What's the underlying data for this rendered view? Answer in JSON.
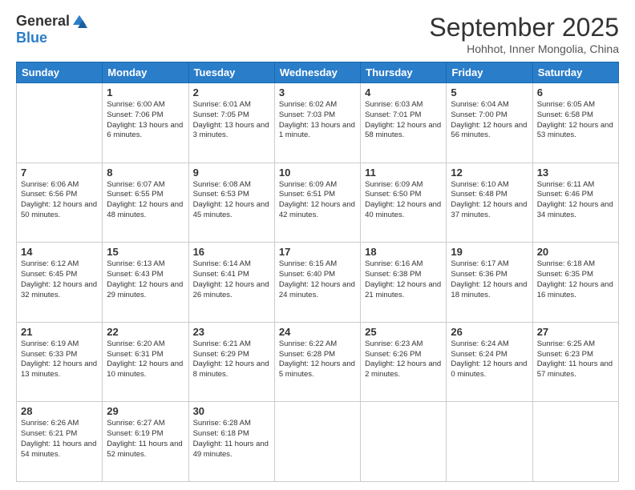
{
  "logo": {
    "general": "General",
    "blue": "Blue"
  },
  "title": "September 2025",
  "subtitle": "Hohhot, Inner Mongolia, China",
  "days_header": [
    "Sunday",
    "Monday",
    "Tuesday",
    "Wednesday",
    "Thursday",
    "Friday",
    "Saturday"
  ],
  "weeks": [
    [
      {
        "day": "",
        "sunrise": "",
        "sunset": "",
        "daylight": ""
      },
      {
        "day": "1",
        "sunrise": "Sunrise: 6:00 AM",
        "sunset": "Sunset: 7:06 PM",
        "daylight": "Daylight: 13 hours and 6 minutes."
      },
      {
        "day": "2",
        "sunrise": "Sunrise: 6:01 AM",
        "sunset": "Sunset: 7:05 PM",
        "daylight": "Daylight: 13 hours and 3 minutes."
      },
      {
        "day": "3",
        "sunrise": "Sunrise: 6:02 AM",
        "sunset": "Sunset: 7:03 PM",
        "daylight": "Daylight: 13 hours and 1 minute."
      },
      {
        "day": "4",
        "sunrise": "Sunrise: 6:03 AM",
        "sunset": "Sunset: 7:01 PM",
        "daylight": "Daylight: 12 hours and 58 minutes."
      },
      {
        "day": "5",
        "sunrise": "Sunrise: 6:04 AM",
        "sunset": "Sunset: 7:00 PM",
        "daylight": "Daylight: 12 hours and 56 minutes."
      },
      {
        "day": "6",
        "sunrise": "Sunrise: 6:05 AM",
        "sunset": "Sunset: 6:58 PM",
        "daylight": "Daylight: 12 hours and 53 minutes."
      }
    ],
    [
      {
        "day": "7",
        "sunrise": "Sunrise: 6:06 AM",
        "sunset": "Sunset: 6:56 PM",
        "daylight": "Daylight: 12 hours and 50 minutes."
      },
      {
        "day": "8",
        "sunrise": "Sunrise: 6:07 AM",
        "sunset": "Sunset: 6:55 PM",
        "daylight": "Daylight: 12 hours and 48 minutes."
      },
      {
        "day": "9",
        "sunrise": "Sunrise: 6:08 AM",
        "sunset": "Sunset: 6:53 PM",
        "daylight": "Daylight: 12 hours and 45 minutes."
      },
      {
        "day": "10",
        "sunrise": "Sunrise: 6:09 AM",
        "sunset": "Sunset: 6:51 PM",
        "daylight": "Daylight: 12 hours and 42 minutes."
      },
      {
        "day": "11",
        "sunrise": "Sunrise: 6:09 AM",
        "sunset": "Sunset: 6:50 PM",
        "daylight": "Daylight: 12 hours and 40 minutes."
      },
      {
        "day": "12",
        "sunrise": "Sunrise: 6:10 AM",
        "sunset": "Sunset: 6:48 PM",
        "daylight": "Daylight: 12 hours and 37 minutes."
      },
      {
        "day": "13",
        "sunrise": "Sunrise: 6:11 AM",
        "sunset": "Sunset: 6:46 PM",
        "daylight": "Daylight: 12 hours and 34 minutes."
      }
    ],
    [
      {
        "day": "14",
        "sunrise": "Sunrise: 6:12 AM",
        "sunset": "Sunset: 6:45 PM",
        "daylight": "Daylight: 12 hours and 32 minutes."
      },
      {
        "day": "15",
        "sunrise": "Sunrise: 6:13 AM",
        "sunset": "Sunset: 6:43 PM",
        "daylight": "Daylight: 12 hours and 29 minutes."
      },
      {
        "day": "16",
        "sunrise": "Sunrise: 6:14 AM",
        "sunset": "Sunset: 6:41 PM",
        "daylight": "Daylight: 12 hours and 26 minutes."
      },
      {
        "day": "17",
        "sunrise": "Sunrise: 6:15 AM",
        "sunset": "Sunset: 6:40 PM",
        "daylight": "Daylight: 12 hours and 24 minutes."
      },
      {
        "day": "18",
        "sunrise": "Sunrise: 6:16 AM",
        "sunset": "Sunset: 6:38 PM",
        "daylight": "Daylight: 12 hours and 21 minutes."
      },
      {
        "day": "19",
        "sunrise": "Sunrise: 6:17 AM",
        "sunset": "Sunset: 6:36 PM",
        "daylight": "Daylight: 12 hours and 18 minutes."
      },
      {
        "day": "20",
        "sunrise": "Sunrise: 6:18 AM",
        "sunset": "Sunset: 6:35 PM",
        "daylight": "Daylight: 12 hours and 16 minutes."
      }
    ],
    [
      {
        "day": "21",
        "sunrise": "Sunrise: 6:19 AM",
        "sunset": "Sunset: 6:33 PM",
        "daylight": "Daylight: 12 hours and 13 minutes."
      },
      {
        "day": "22",
        "sunrise": "Sunrise: 6:20 AM",
        "sunset": "Sunset: 6:31 PM",
        "daylight": "Daylight: 12 hours and 10 minutes."
      },
      {
        "day": "23",
        "sunrise": "Sunrise: 6:21 AM",
        "sunset": "Sunset: 6:29 PM",
        "daylight": "Daylight: 12 hours and 8 minutes."
      },
      {
        "day": "24",
        "sunrise": "Sunrise: 6:22 AM",
        "sunset": "Sunset: 6:28 PM",
        "daylight": "Daylight: 12 hours and 5 minutes."
      },
      {
        "day": "25",
        "sunrise": "Sunrise: 6:23 AM",
        "sunset": "Sunset: 6:26 PM",
        "daylight": "Daylight: 12 hours and 2 minutes."
      },
      {
        "day": "26",
        "sunrise": "Sunrise: 6:24 AM",
        "sunset": "Sunset: 6:24 PM",
        "daylight": "Daylight: 12 hours and 0 minutes."
      },
      {
        "day": "27",
        "sunrise": "Sunrise: 6:25 AM",
        "sunset": "Sunset: 6:23 PM",
        "daylight": "Daylight: 11 hours and 57 minutes."
      }
    ],
    [
      {
        "day": "28",
        "sunrise": "Sunrise: 6:26 AM",
        "sunset": "Sunset: 6:21 PM",
        "daylight": "Daylight: 11 hours and 54 minutes."
      },
      {
        "day": "29",
        "sunrise": "Sunrise: 6:27 AM",
        "sunset": "Sunset: 6:19 PM",
        "daylight": "Daylight: 11 hours and 52 minutes."
      },
      {
        "day": "30",
        "sunrise": "Sunrise: 6:28 AM",
        "sunset": "Sunset: 6:18 PM",
        "daylight": "Daylight: 11 hours and 49 minutes."
      },
      {
        "day": "",
        "sunrise": "",
        "sunset": "",
        "daylight": ""
      },
      {
        "day": "",
        "sunrise": "",
        "sunset": "",
        "daylight": ""
      },
      {
        "day": "",
        "sunrise": "",
        "sunset": "",
        "daylight": ""
      },
      {
        "day": "",
        "sunrise": "",
        "sunset": "",
        "daylight": ""
      }
    ]
  ]
}
